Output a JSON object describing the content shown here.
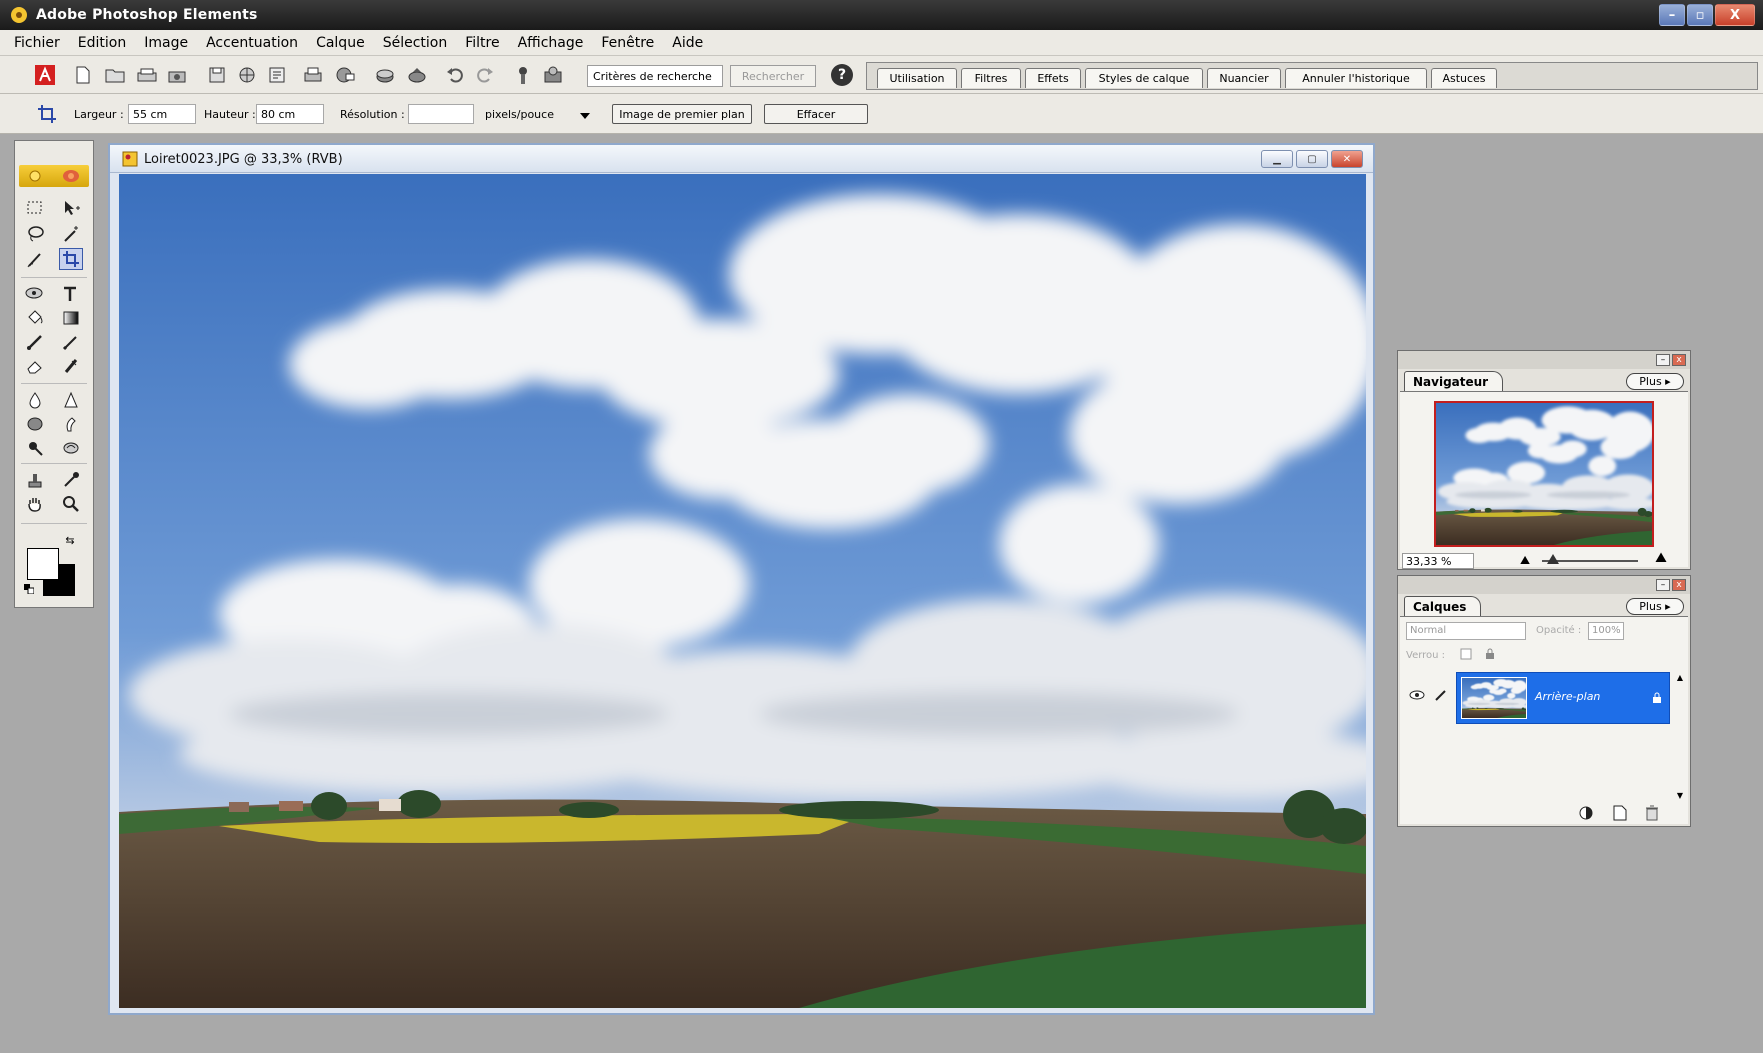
{
  "app": {
    "title": "Adobe Photoshop Elements"
  },
  "window_controls": {
    "minimize": "–",
    "maximize": "▫",
    "close": "X"
  },
  "menu": [
    "Fichier",
    "Edition",
    "Image",
    "Accentuation",
    "Calque",
    "Sélection",
    "Filtre",
    "Affichage",
    "Fenêtre",
    "Aide"
  ],
  "shortcuts": {
    "search_value": "Critères de recherche",
    "search_button": "Rechercher",
    "palette_tabs": [
      "Utilisation",
      "Filtres",
      "Effets",
      "Styles de calque",
      "Nuancier",
      "Annuler l'historique",
      "Astuces"
    ]
  },
  "options": {
    "width_label": "Largeur :",
    "width_value": "55 cm",
    "height_label": "Hauteur :",
    "height_value": "80 cm",
    "resolution_label": "Résolution :",
    "resolution_value": "",
    "unit_value": "pixels/pouce",
    "front_image_button": "Image de premier plan",
    "clear_button": "Effacer"
  },
  "document": {
    "title": "Loiret0023.JPG @ 33,3% (RVB)",
    "zoom_percent": 33.3
  },
  "navigator": {
    "tab": "Navigateur",
    "more": "Plus",
    "zoom_value": "33,33 %"
  },
  "layers": {
    "tab": "Calques",
    "more": "Plus",
    "blend_mode": "Normal",
    "opacity_label": "Opacité :",
    "opacity_value": "100%",
    "lock_label": "Verrou :",
    "layer_name": "Arrière-plan"
  },
  "colors": {
    "accent_yellow": "#f7ce3a",
    "selection_blue": "#1e6ee8",
    "navigator_frame": "#c31e1e",
    "sky": "#4b7fc7"
  }
}
